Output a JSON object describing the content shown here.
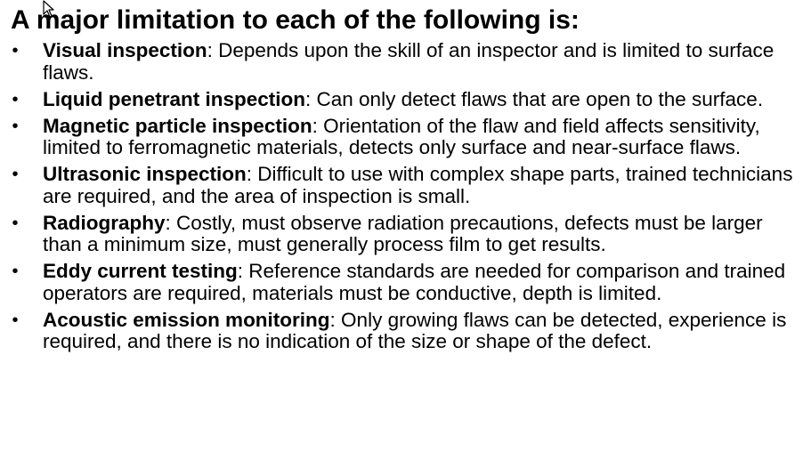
{
  "slide": {
    "title": "A major limitation to each of the following is:",
    "bullet_glyph": "•",
    "items": [
      {
        "term": "Visual inspection",
        "text": ": Depends upon the skill of an inspector and is limited to surface flaws."
      },
      {
        "term": "Liquid penetrant inspection",
        "text": ": Can only detect flaws that are open to the surface."
      },
      {
        "term": "Magnetic particle inspection",
        "text": ": Orientation of the flaw and field affects sensitivity, limited to ferromagnetic materials, detects only surface and near-surface flaws."
      },
      {
        "term": "Ultrasonic inspection",
        "text": ": Difficult to use with complex shape parts, trained technicians are required, and the area of inspection is small."
      },
      {
        "term": "Radiography",
        "text": ": Costly, must observe radiation precautions, defects must be larger than a minimum size, must generally process film to get results."
      },
      {
        "term": "Eddy current testing",
        "text": ": Reference standards are needed for comparison and trained operators are required, materials must be conductive, depth is limited."
      },
      {
        "term": "Acoustic emission monitoring",
        "text": ": Only growing flaws can be detected, experience is required, and there is no indication of the size or shape of the defect."
      }
    ]
  },
  "cursor": {
    "icon": "mouse-pointer-icon",
    "color": "#000000"
  }
}
